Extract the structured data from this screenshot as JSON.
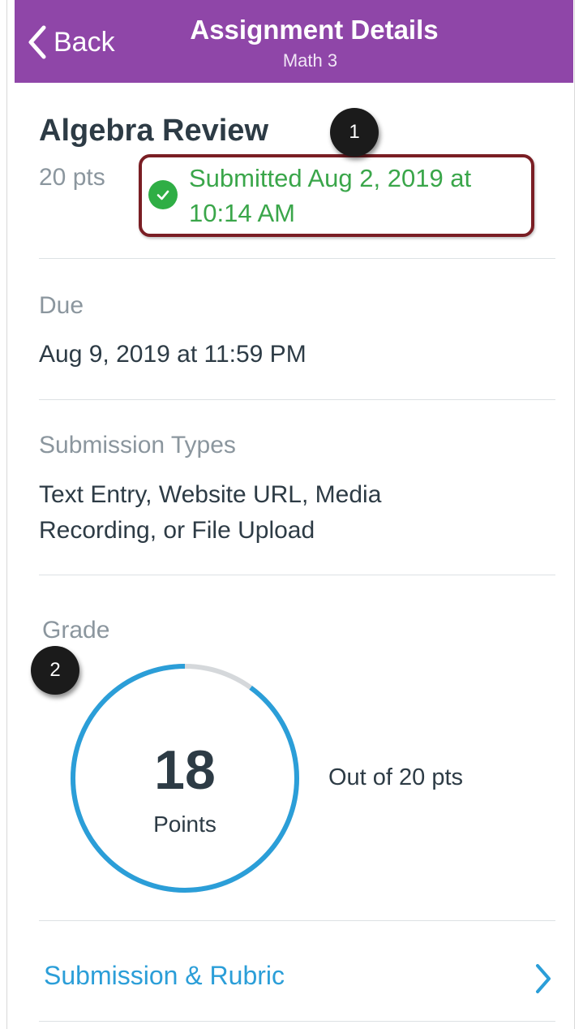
{
  "nav": {
    "back_label": "Back",
    "title": "Assignment Details",
    "subtitle": "Math 3"
  },
  "assignment": {
    "title": "Algebra Review",
    "points": "20 pts",
    "submitted_status": "Submitted Aug 2, 2019 at 10:14 AM"
  },
  "callouts": [
    "1",
    "2"
  ],
  "due": {
    "label": "Due",
    "value": "Aug 9, 2019 at 11:59 PM"
  },
  "submission_types": {
    "label": "Submission Types",
    "value": "Text Entry, Website URL, Media Recording, or File Upload"
  },
  "grade": {
    "label": "Grade",
    "score": "18",
    "unit": "Points",
    "out_of": "Out of 20 pts",
    "fraction": 0.9
  },
  "rubric": {
    "label": "Submission & Rubric"
  },
  "colors": {
    "navbar": "#8f46a8",
    "success": "#2fae45",
    "link": "#2b9ed8",
    "ring": "#2b9ed8",
    "highlight_box": "#7a1e24"
  },
  "icons": {
    "back": "chevron-left-icon",
    "status": "check-circle-icon",
    "rubric": "chevron-right-icon"
  }
}
